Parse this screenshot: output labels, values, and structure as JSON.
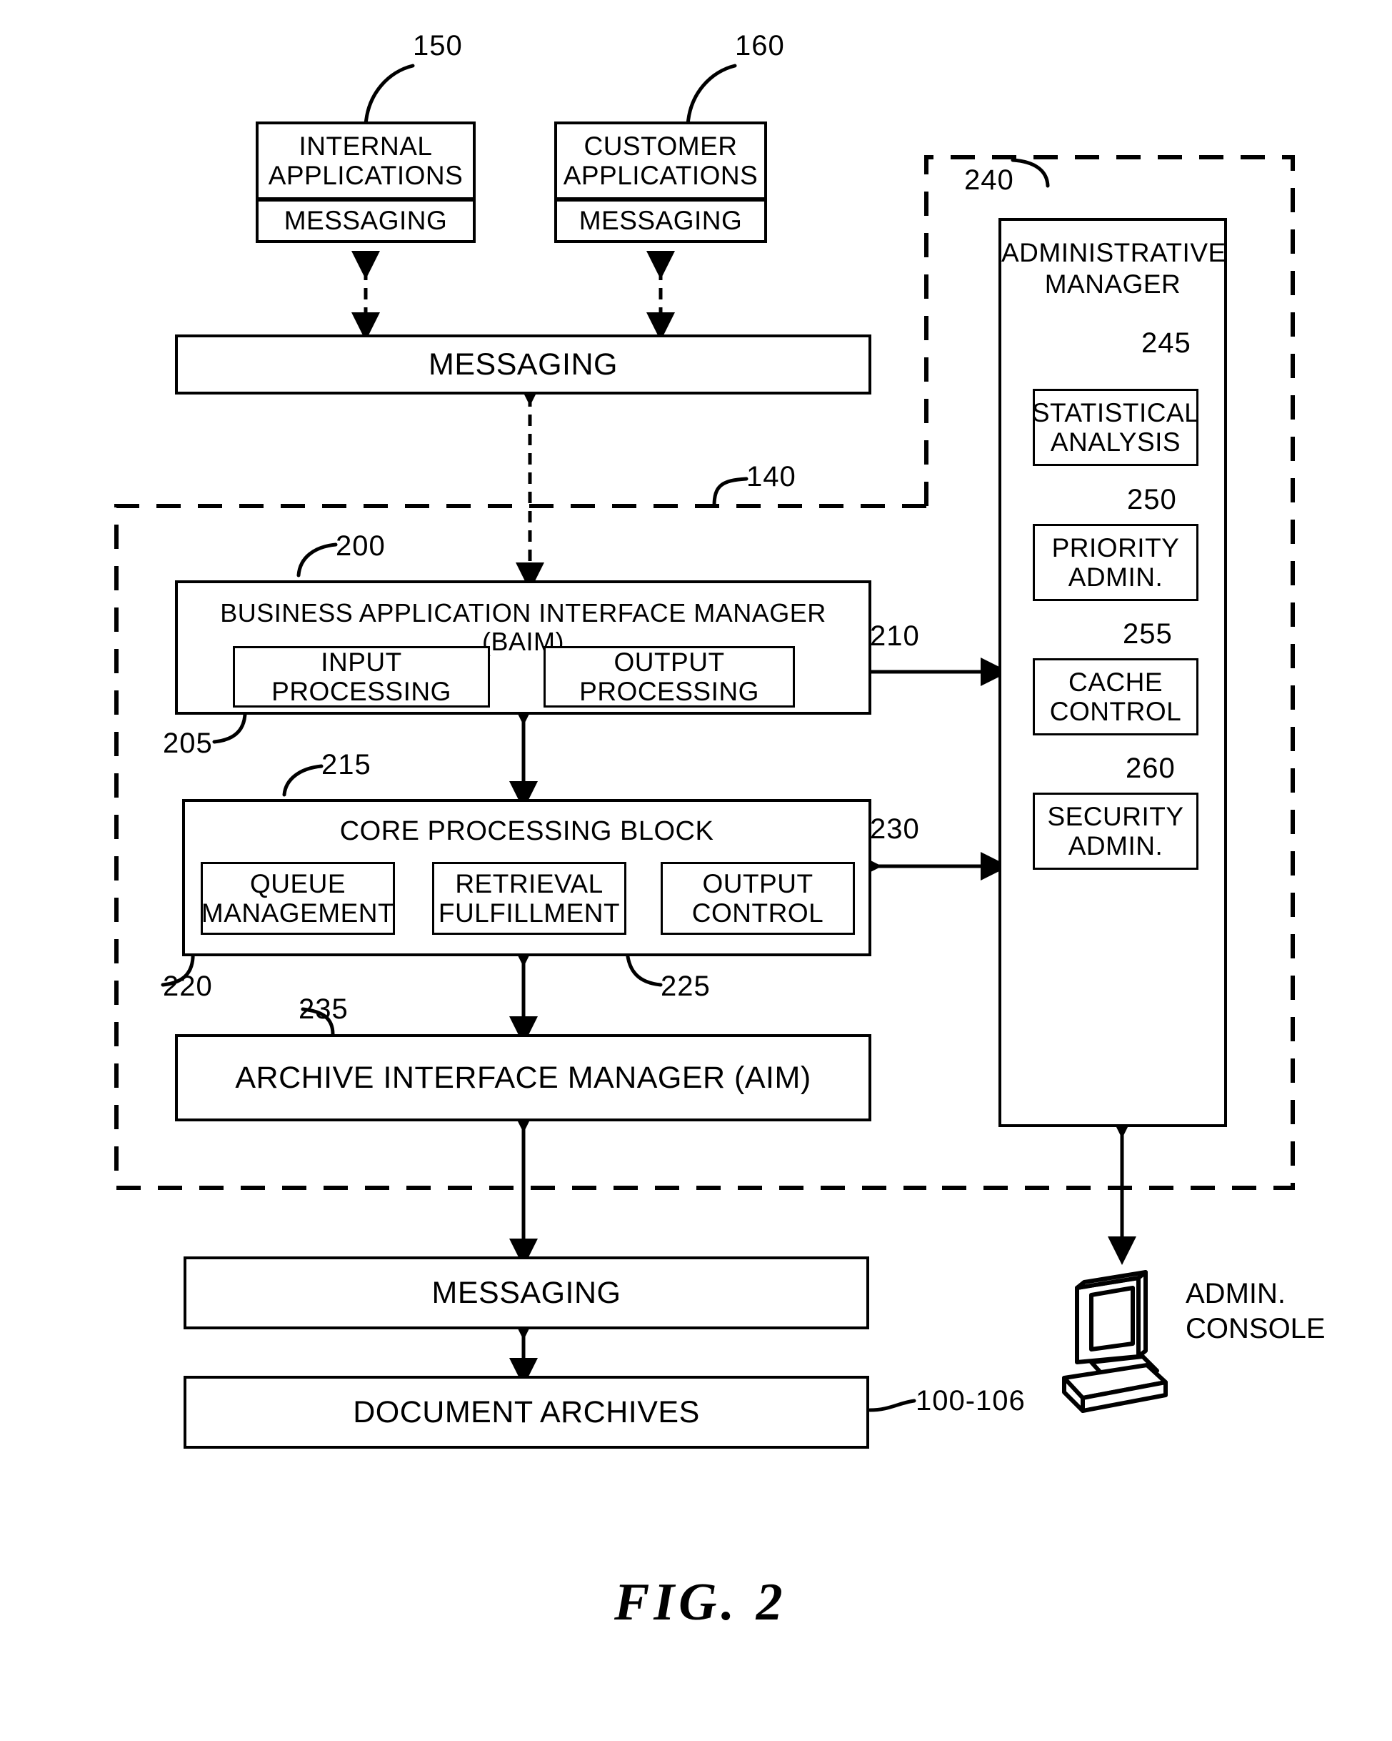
{
  "figure": {
    "caption": "FIG.  2"
  },
  "top_applications": [
    {
      "id": "internal-applications",
      "title_line1": "INTERNAL",
      "title_line2": "APPLICATIONS",
      "sub_label": "MESSAGING",
      "ref": "150"
    },
    {
      "id": "customer-applications",
      "title_line1": "CUSTOMER",
      "title_line2": "APPLICATIONS",
      "sub_label": "MESSAGING",
      "ref": "160"
    }
  ],
  "messaging_top": {
    "label": "MESSAGING"
  },
  "system_boundary": {
    "ref": "140"
  },
  "baim": {
    "title": "BUSINESS APPLICATION  INTERFACE  MANAGER  (BAIM)",
    "ref": "200",
    "connector_ref": "210",
    "children": [
      {
        "id": "input-processing",
        "line1": "INPUT",
        "line2": "PROCESSING",
        "ref": "205"
      },
      {
        "id": "output-processing",
        "line1": "OUTPUT",
        "line2": "PROCESSING",
        "ref": ""
      }
    ]
  },
  "core_processing": {
    "title": "CORE  PROCESSING  BLOCK",
    "ref": "215",
    "children": [
      {
        "id": "queue-management",
        "line1": "QUEUE",
        "line2": "MANAGEMENT",
        "ref": "220"
      },
      {
        "id": "retrieval-fulfillment",
        "line1": "RETRIEVAL",
        "line2": "FULFILLMENT",
        "ref": "225"
      },
      {
        "id": "output-control",
        "line1": "OUTPUT",
        "line2": "CONTROL",
        "ref": "230"
      }
    ]
  },
  "aim": {
    "label": "ARCHIVE  INTERFACE  MANAGER  (AIM)",
    "ref": "235"
  },
  "messaging_bottom": {
    "label": "MESSAGING"
  },
  "document_archives": {
    "label": "DOCUMENT  ARCHIVES",
    "ref": "100-106"
  },
  "admin_manager": {
    "title_line1": "ADMINISTRATIVE",
    "title_line2": "MANAGER",
    "ref": "240",
    "children": [
      {
        "id": "statistical-analysis",
        "line1": "STATISTICAL",
        "line2": "ANALYSIS",
        "ref": "245"
      },
      {
        "id": "priority-admin",
        "line1": "PRIORITY",
        "line2": "ADMIN.",
        "ref": "250"
      },
      {
        "id": "cache-control",
        "line1": "CACHE",
        "line2": "CONTROL",
        "ref": "255"
      },
      {
        "id": "security-admin",
        "line1": "SECURITY",
        "line2": "ADMIN.",
        "ref": "260"
      }
    ]
  },
  "admin_console": {
    "line1": "ADMIN.",
    "line2": "CONSOLE",
    "icon": "computer-workstation-icon"
  },
  "colors": {
    "ink": "#000000",
    "paper": "#ffffff"
  }
}
